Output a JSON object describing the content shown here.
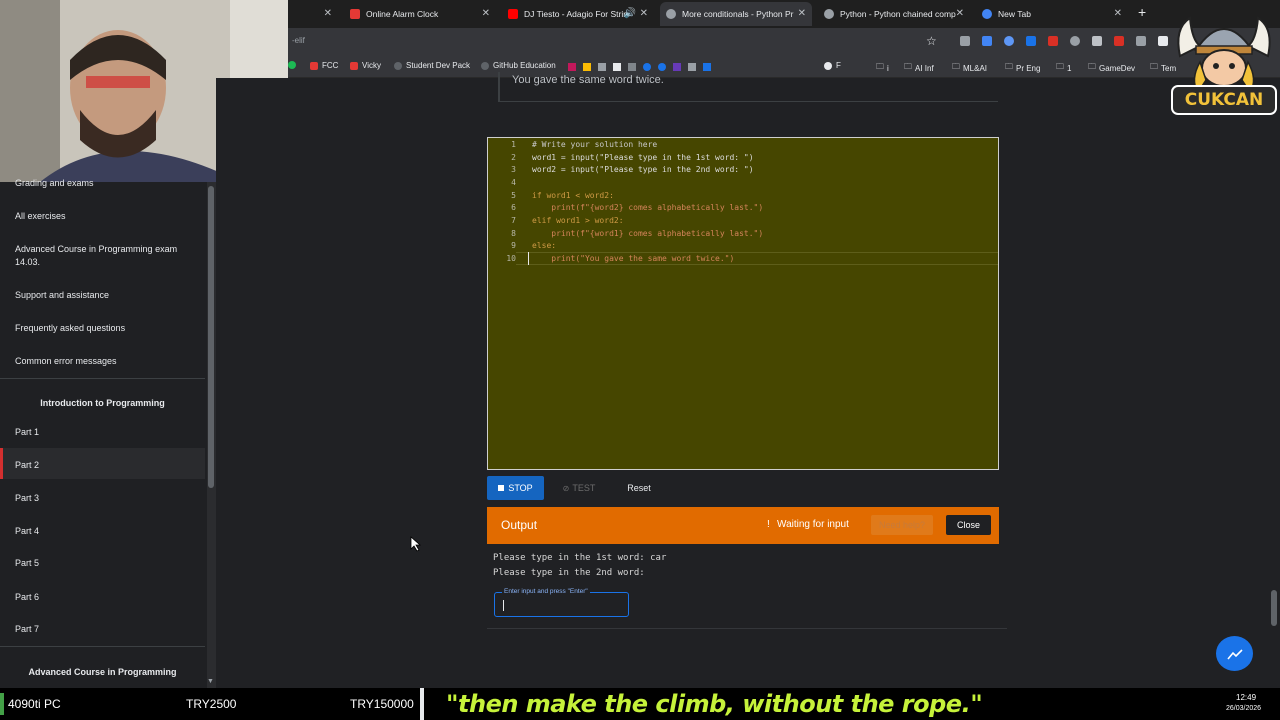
{
  "tabs": [
    {
      "title": "Online Alarm Clock",
      "color": "#e53935"
    },
    {
      "title": "DJ Tiesto - Adagio For Strin",
      "color": "#ff0000"
    },
    {
      "title": "More conditionals - Python Pr",
      "color": "#9aa0a6"
    },
    {
      "title": "Python - Python chained comp",
      "color": "#9aa0a6"
    },
    {
      "title": "New Tab",
      "color": "#4285f4"
    }
  ],
  "address": {
    "url": "-elif"
  },
  "bookmarks": [
    "FCC",
    "Vicky",
    "Student Dev Pack",
    "GitHub Education",
    "F",
    "i",
    "AI Inf",
    "ML&AI",
    "Pr Eng",
    "1",
    "GameDev",
    "Tem"
  ],
  "content_top_text": "You gave the same word twice.",
  "sidebar": {
    "items": [
      "Grading and exams",
      "All exercises",
      "Advanced Course in Programming exam 14.03.",
      "Support and assistance",
      "Frequently asked questions",
      "Common error messages"
    ],
    "intro_heading": "Introduction to Programming",
    "parts": [
      "Part 1",
      "Part 2",
      "Part 3",
      "Part 4",
      "Part 5",
      "Part 6",
      "Part 7"
    ],
    "advanced_heading": "Advanced Course in Programming"
  },
  "editor": {
    "line_numbers": [
      "1",
      "2",
      "3",
      "4",
      "5",
      "6",
      "7",
      "8",
      "9",
      "10"
    ],
    "lines": [
      "# Write your solution here",
      "word1 = input(\"Please type in the 1st word: \")",
      "word2 = input(\"Please type in the 2nd word: \")",
      "",
      "if word1 < word2:",
      "    print(f\"{word2} comes alphabetically last.\")",
      "elif word1 > word2:",
      "    print(f\"{word1} comes alphabetically last.\")",
      "else:",
      "    print(\"You gave the same word twice.\")"
    ]
  },
  "buttons": {
    "stop": "STOP",
    "test": "TEST",
    "reset": "Reset"
  },
  "output": {
    "title": "Output",
    "status": "Waiting for input",
    "need_help": "Need help?",
    "close": "Close",
    "line1": "Please type in the 1st word: car",
    "line2": "Please type in the 2nd word:",
    "input_label": "Enter input and press \"Enter\""
  },
  "taskbar": {
    "pc": "4090ti PC",
    "price1": "TRY2500",
    "price2": "TRY150000",
    "quote": "\"then make the climb, without the rope.\"",
    "time": "12:49",
    "date": "26/03/2026"
  },
  "mascot": {
    "text": "CUKCAN"
  },
  "colors": {
    "accent": "#e16b00",
    "stop_button": "#1565c0",
    "editor_bg": "#464600",
    "quote": "#c6f23a"
  }
}
